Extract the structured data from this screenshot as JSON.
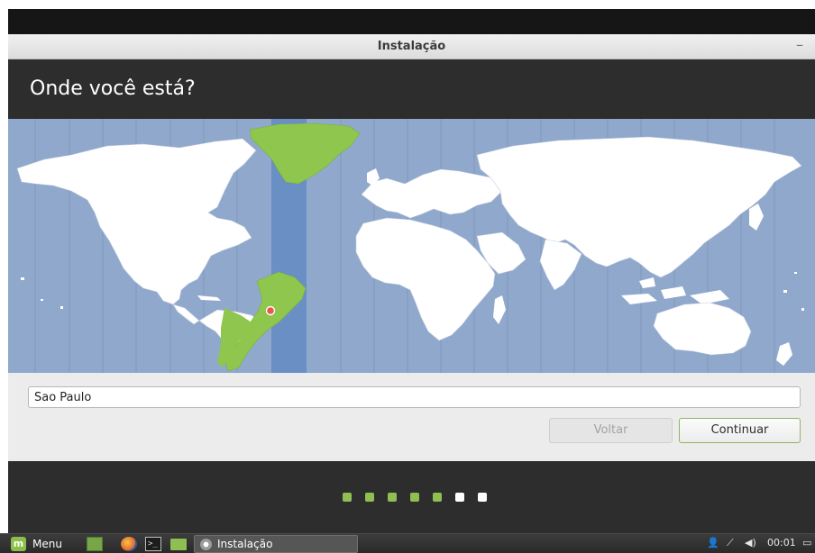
{
  "window": {
    "title": "Instalação",
    "minimize_glyph": "–"
  },
  "page": {
    "heading": "Onde você está?"
  },
  "location": {
    "value": "Sao Paulo"
  },
  "buttons": {
    "back_label": "Voltar",
    "continue_label": "Continuar"
  },
  "progress": {
    "total_steps": 7,
    "completed_steps": 5,
    "completed_color": "#8fbf52",
    "pending_color": "#ffffff"
  },
  "map": {
    "selected_timezone_band_color": "#6a8fc4",
    "ocean_color": "#90a8cc",
    "land_color": "#ffffff",
    "selected_land_color": "#8ec64e",
    "pin_color": "#e65a4a"
  },
  "taskbar": {
    "menu_label": "Menu",
    "menu_icon": "mint-logo-icon",
    "quicklaunch": [
      "files-icon",
      "firefox-icon",
      "terminal-icon",
      "folder-icon"
    ],
    "task_label": "Instalação",
    "tray": {
      "user_glyph": "👤",
      "network_glyph": "⟋",
      "volume_glyph": "◀)",
      "clock": "00:01",
      "desktop_glyph": "▭"
    }
  }
}
